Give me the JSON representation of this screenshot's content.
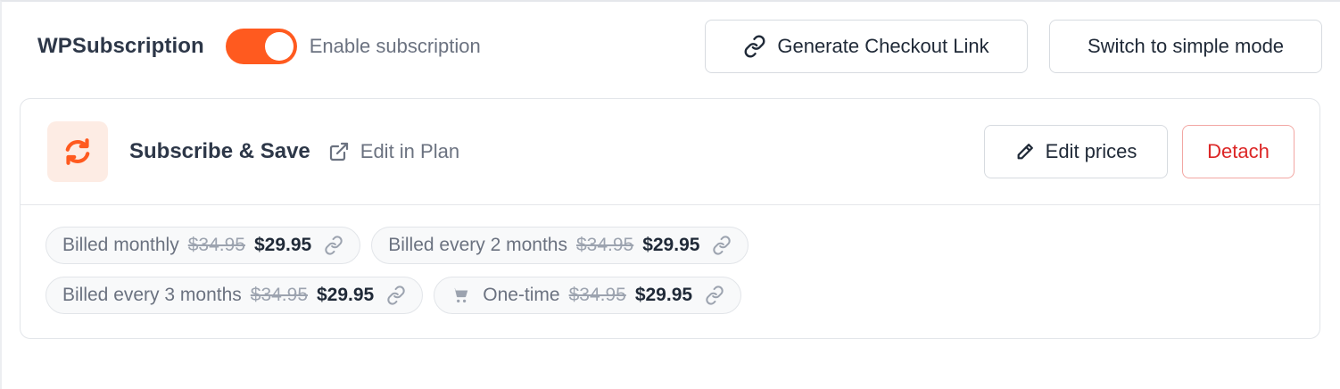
{
  "header": {
    "brand": "WPSubscription",
    "toggle_label": "Enable subscription",
    "toggle_on": true,
    "generate_label": "Generate Checkout Link",
    "switch_label": "Switch to simple mode"
  },
  "plan": {
    "name": "Subscribe & Save",
    "edit_in_plan": "Edit in Plan",
    "edit_prices": "Edit prices",
    "detach": "Detach"
  },
  "prices": [
    {
      "label": "Billed monthly",
      "old": "$34.95",
      "price": "$29.95"
    },
    {
      "label": "Billed every 2 months",
      "old": "$34.95",
      "price": "$29.95"
    },
    {
      "label": "Billed every 3 months",
      "old": "$34.95",
      "price": "$29.95"
    },
    {
      "label": "One-time",
      "old": "$34.95",
      "price": "$29.95",
      "icon": "cart-icon"
    }
  ],
  "colors": {
    "accent": "#ff5a1f",
    "danger": "#dc2626",
    "icon_bg": "#fdece4"
  }
}
